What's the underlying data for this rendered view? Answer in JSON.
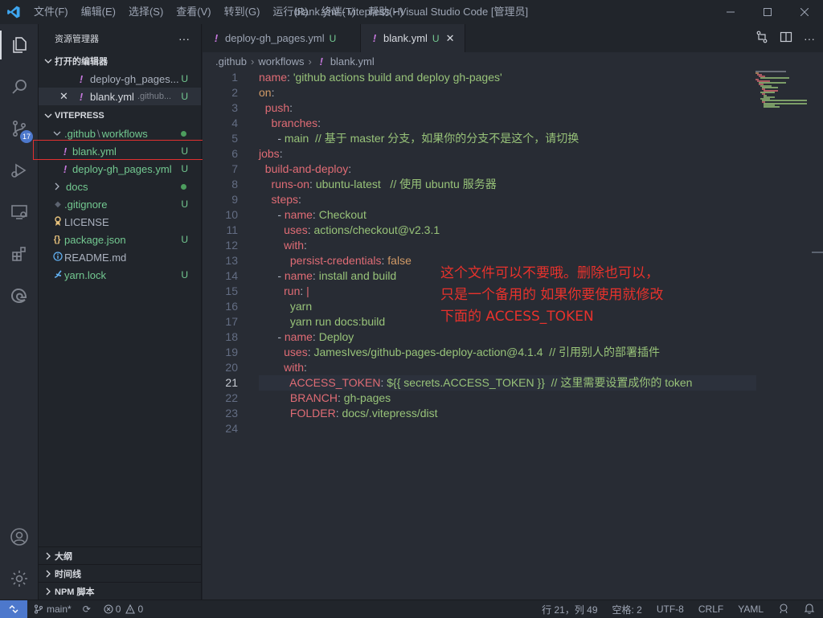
{
  "window": {
    "title": "blank.yml - vitepress - Visual Studio Code [管理员]"
  },
  "menu": [
    "文件(F)",
    "编辑(E)",
    "选择(S)",
    "查看(V)",
    "转到(G)",
    "运行(R)",
    "终端(T)",
    "帮助(H)"
  ],
  "activity": {
    "scm_badge": "17"
  },
  "sidebar": {
    "title": "资源管理器",
    "open_editors_label": "打开的编辑器",
    "open_editors": [
      {
        "name": "deploy-gh_pages...",
        "status": "U"
      },
      {
        "name": "blank.yml",
        "path": ".github...",
        "status": "U"
      }
    ],
    "project_label": "VITEPRESS",
    "tree": {
      "github_folder": ".github",
      "workflows_folder": "workflows",
      "blank": "blank.yml",
      "deploy": "deploy-gh_pages.yml",
      "docs": "docs",
      "gitignore": ".gitignore",
      "license": "LICENSE",
      "package": "package.json",
      "readme": "README.md",
      "yarn": "yarn.lock",
      "u": "U"
    },
    "outline_label": "大纲",
    "timeline_label": "时间线",
    "npm_label": "NPM 脚本"
  },
  "tabs": [
    {
      "label": "deploy-gh_pages.yml",
      "status": "U"
    },
    {
      "label": "blank.yml",
      "status": "U"
    }
  ],
  "breadcrumb": [
    ".github",
    "workflows",
    "blank.yml"
  ],
  "code": {
    "l1": [
      "name",
      ": ",
      "'github actions build and deploy gh-pages'"
    ],
    "l2": [
      "on",
      ":"
    ],
    "l3": [
      "  push",
      ":"
    ],
    "l4": [
      "    branches",
      ":"
    ],
    "l5": [
      "      - ",
      "main",
      "  // 基于 master 分支，如果你的分支不是这个，请切换"
    ],
    "l6": [
      "jobs",
      ":"
    ],
    "l7": [
      "  build-and-deploy",
      ":"
    ],
    "l8": [
      "    runs-on",
      ": ",
      "ubuntu-latest   // 使用 ubuntu 服务器"
    ],
    "l9": [
      "    steps",
      ":"
    ],
    "l10": [
      "      - ",
      "name",
      ": ",
      "Checkout"
    ],
    "l11": [
      "        uses",
      ": ",
      "actions/checkout@v2.3.1"
    ],
    "l12": [
      "        with",
      ":"
    ],
    "l13": [
      "          persist-credentials",
      ": ",
      "false"
    ],
    "l14": [
      "      - ",
      "name",
      ": ",
      "install and build"
    ],
    "l15": [
      "        run",
      ": ",
      "|"
    ],
    "l16": [
      "          yarn"
    ],
    "l17": [
      "          yarn run docs:build"
    ],
    "l18": [
      "      - ",
      "name",
      ": ",
      "Deploy"
    ],
    "l19": [
      "        uses",
      ": ",
      "JamesIves/github-pages-deploy-action@4.1.4  // 引用别人的部署插件"
    ],
    "l20": [
      "        with",
      ":"
    ],
    "l21": [
      "          ACCESS_TOKEN",
      ": ",
      "${{ secrets.ACCESS_TOKEN }}",
      "  // 这里需要设置成你的 token"
    ],
    "l22": [
      "          BRANCH",
      ": ",
      "gh-pages"
    ],
    "l23": [
      "          FOLDER",
      ": ",
      "docs/.vitepress/dist"
    ]
  },
  "annotation": [
    "这个文件可以不要哦。删除也可以，",
    "只是一个备用的  如果你要使用就修改",
    "下面的 ACCESS_TOKEN"
  ],
  "status": {
    "branch": "main*",
    "errors": "0",
    "warnings": "0",
    "position": "行 21，列 49",
    "spaces": "空格: 2",
    "encoding": "UTF-8",
    "eol": "CRLF",
    "language": "YAML"
  },
  "colors": {
    "accent": "#4d78cc",
    "annotation": "#e8322c",
    "untracked": "#73c991"
  }
}
